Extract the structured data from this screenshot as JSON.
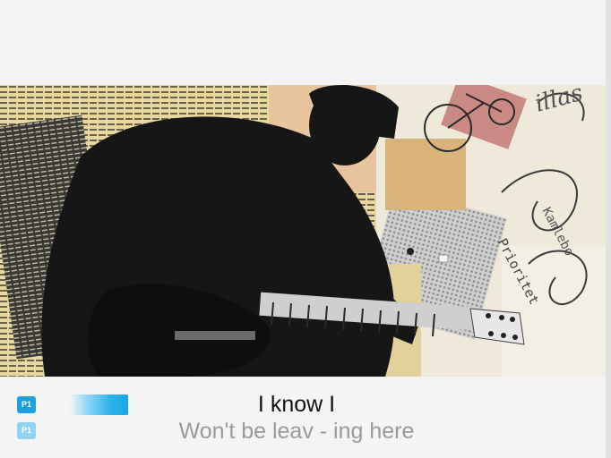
{
  "lyrics": {
    "current_line": "I know I",
    "next_line": "Won't be leav - ing here"
  },
  "players": {
    "primary_label": "P1",
    "secondary_label": "P1"
  },
  "video_collage_text": {
    "postcard_word": "Prioritet",
    "postcard_fragment": "Kamlebo",
    "script_fragment": "illas"
  },
  "colors": {
    "player_blue": "#1e9fe0",
    "player_blue_light": "#8fd2f2",
    "current_lyric": "#111111",
    "next_lyric": "#9a9a9a",
    "panel_background": "#f4f4f4"
  },
  "icons": {
    "player_badge": "p1-badge-icon",
    "note_bar": "note-bar-icon"
  }
}
